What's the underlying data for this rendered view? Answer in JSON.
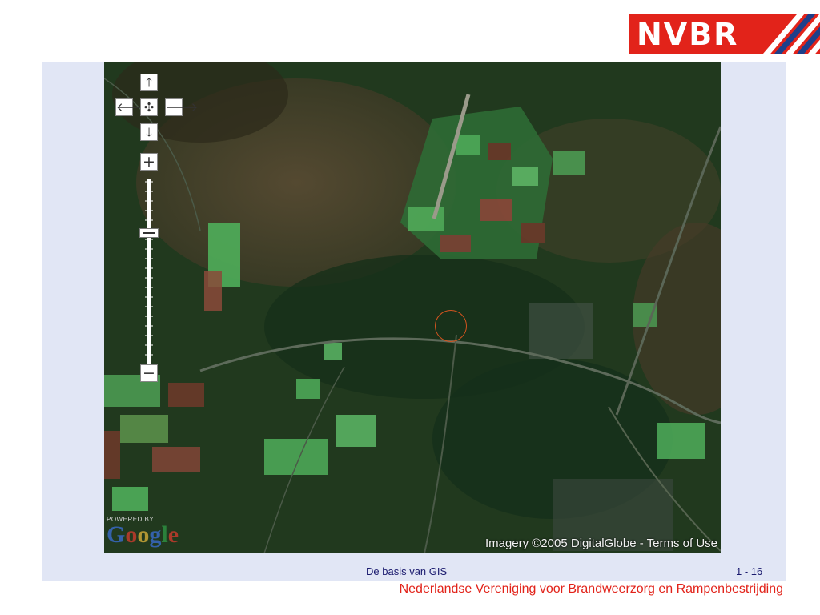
{
  "logo": {
    "text": "NVBR",
    "brand_color": "#e2231a"
  },
  "map": {
    "controls": {
      "pan_up": "🡑",
      "pan_left": "🡐",
      "pan_center": "✣",
      "pan_right": "🡒",
      "pan_down": "🡓",
      "zoom_in": "+",
      "zoom_out": "−"
    },
    "google_logo": {
      "powered": "POWERED BY",
      "word": "Google"
    },
    "copyright": "Imagery ©2005 DigitalGlobe - Terms of Use",
    "highlight_color": "#d2541f"
  },
  "footer": {
    "title": "De basis van GIS",
    "page": "1 - 16",
    "organization": "Nederlandse Vereniging voor Brandweerzorg en Rampenbestrijding"
  },
  "colors": {
    "panel": "#e1e6f5",
    "footer_text": "#1a1a6e",
    "org_text": "#e2231a"
  }
}
